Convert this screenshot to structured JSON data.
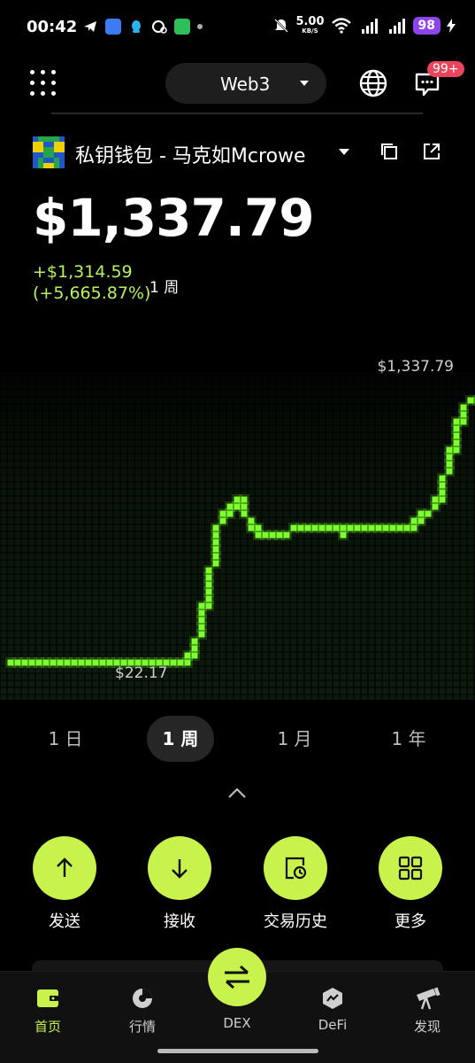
{
  "status_bar": {
    "time": "00:42",
    "speed_value": "5.00",
    "speed_unit": "KB/S",
    "battery": "98"
  },
  "header": {
    "network": "Web3",
    "notification_badge": "99+"
  },
  "wallet": {
    "name": "私钥钱包 - 马克如Mcrowe",
    "balance": "$1,337.79",
    "change_amount": "+$1,314.59",
    "change_percent": "(+5,665.87%)",
    "change_period": "1 周"
  },
  "chart": {
    "max_label": "$1,337.79",
    "min_label": "$22.17"
  },
  "chart_data": {
    "type": "line",
    "x": [
      0,
      1,
      2,
      3,
      4,
      5,
      6,
      7,
      8,
      9,
      10,
      11,
      12,
      13,
      14,
      15,
      16,
      17,
      18,
      19,
      20,
      21,
      22,
      23,
      24,
      25,
      26,
      27,
      28,
      29,
      30,
      31,
      32,
      33,
      34,
      35,
      36,
      37,
      38,
      39,
      40,
      41,
      42,
      43,
      44,
      45,
      46,
      47,
      48,
      49,
      50,
      51,
      52,
      53,
      54,
      55,
      56,
      57,
      58,
      59,
      60,
      61,
      62,
      63,
      64,
      65,
      66,
      67,
      68,
      69,
      70,
      71,
      72,
      73,
      74,
      75,
      76,
      77,
      78,
      79,
      80,
      81,
      82,
      83,
      84,
      85,
      86,
      87,
      88,
      89,
      90
    ],
    "values": [
      22.17,
      22.17,
      22.17,
      22.17,
      22.17,
      22.17,
      22.17,
      22.17,
      22.17,
      22.17,
      22.17,
      22.17,
      22.17,
      22.17,
      22.17,
      22.17,
      22.17,
      22.17,
      22.17,
      22.17,
      22.17,
      22.17,
      22.17,
      22.17,
      22.17,
      22.17,
      22.17,
      22.17,
      22.17,
      22.17,
      22.17,
      22.17,
      22.17,
      22.17,
      22.17,
      22.17,
      60,
      160,
      280,
      400,
      600,
      720,
      750,
      760,
      800,
      820,
      760,
      700,
      660,
      640,
      640,
      640,
      640,
      640,
      660,
      680,
      680,
      680,
      680,
      680,
      680,
      680,
      680,
      680,
      680,
      660,
      680,
      700,
      700,
      700,
      700,
      700,
      700,
      700,
      700,
      700,
      700,
      700,
      700,
      720,
      740,
      760,
      780,
      820,
      900,
      1000,
      1100,
      1200,
      1270,
      1320,
      1337.79
    ],
    "series_color": "#7cff2e"
  },
  "periods": [
    "1 日",
    "1 周",
    "1 月",
    "1 年"
  ],
  "active_period_index": 1,
  "actions": [
    {
      "label": "发送",
      "icon": "arrow-up-icon"
    },
    {
      "label": "接收",
      "icon": "arrow-down-icon"
    },
    {
      "label": "交易历史",
      "icon": "history-icon"
    },
    {
      "label": "更多",
      "icon": "grid-icon"
    }
  ],
  "nav": [
    {
      "label": "首页",
      "icon": "wallet-icon"
    },
    {
      "label": "行情",
      "icon": "market-icon"
    },
    {
      "label": "DEX",
      "icon": "swap-icon"
    },
    {
      "label": "DeFi",
      "icon": "defi-icon"
    },
    {
      "label": "发现",
      "icon": "telescope-icon"
    }
  ],
  "colors": {
    "accent": "#c8f24c",
    "gain": "#b6f35c",
    "chart_line": "#7cff2e",
    "badge": "#e9455c",
    "battery": "#8e44ec"
  }
}
